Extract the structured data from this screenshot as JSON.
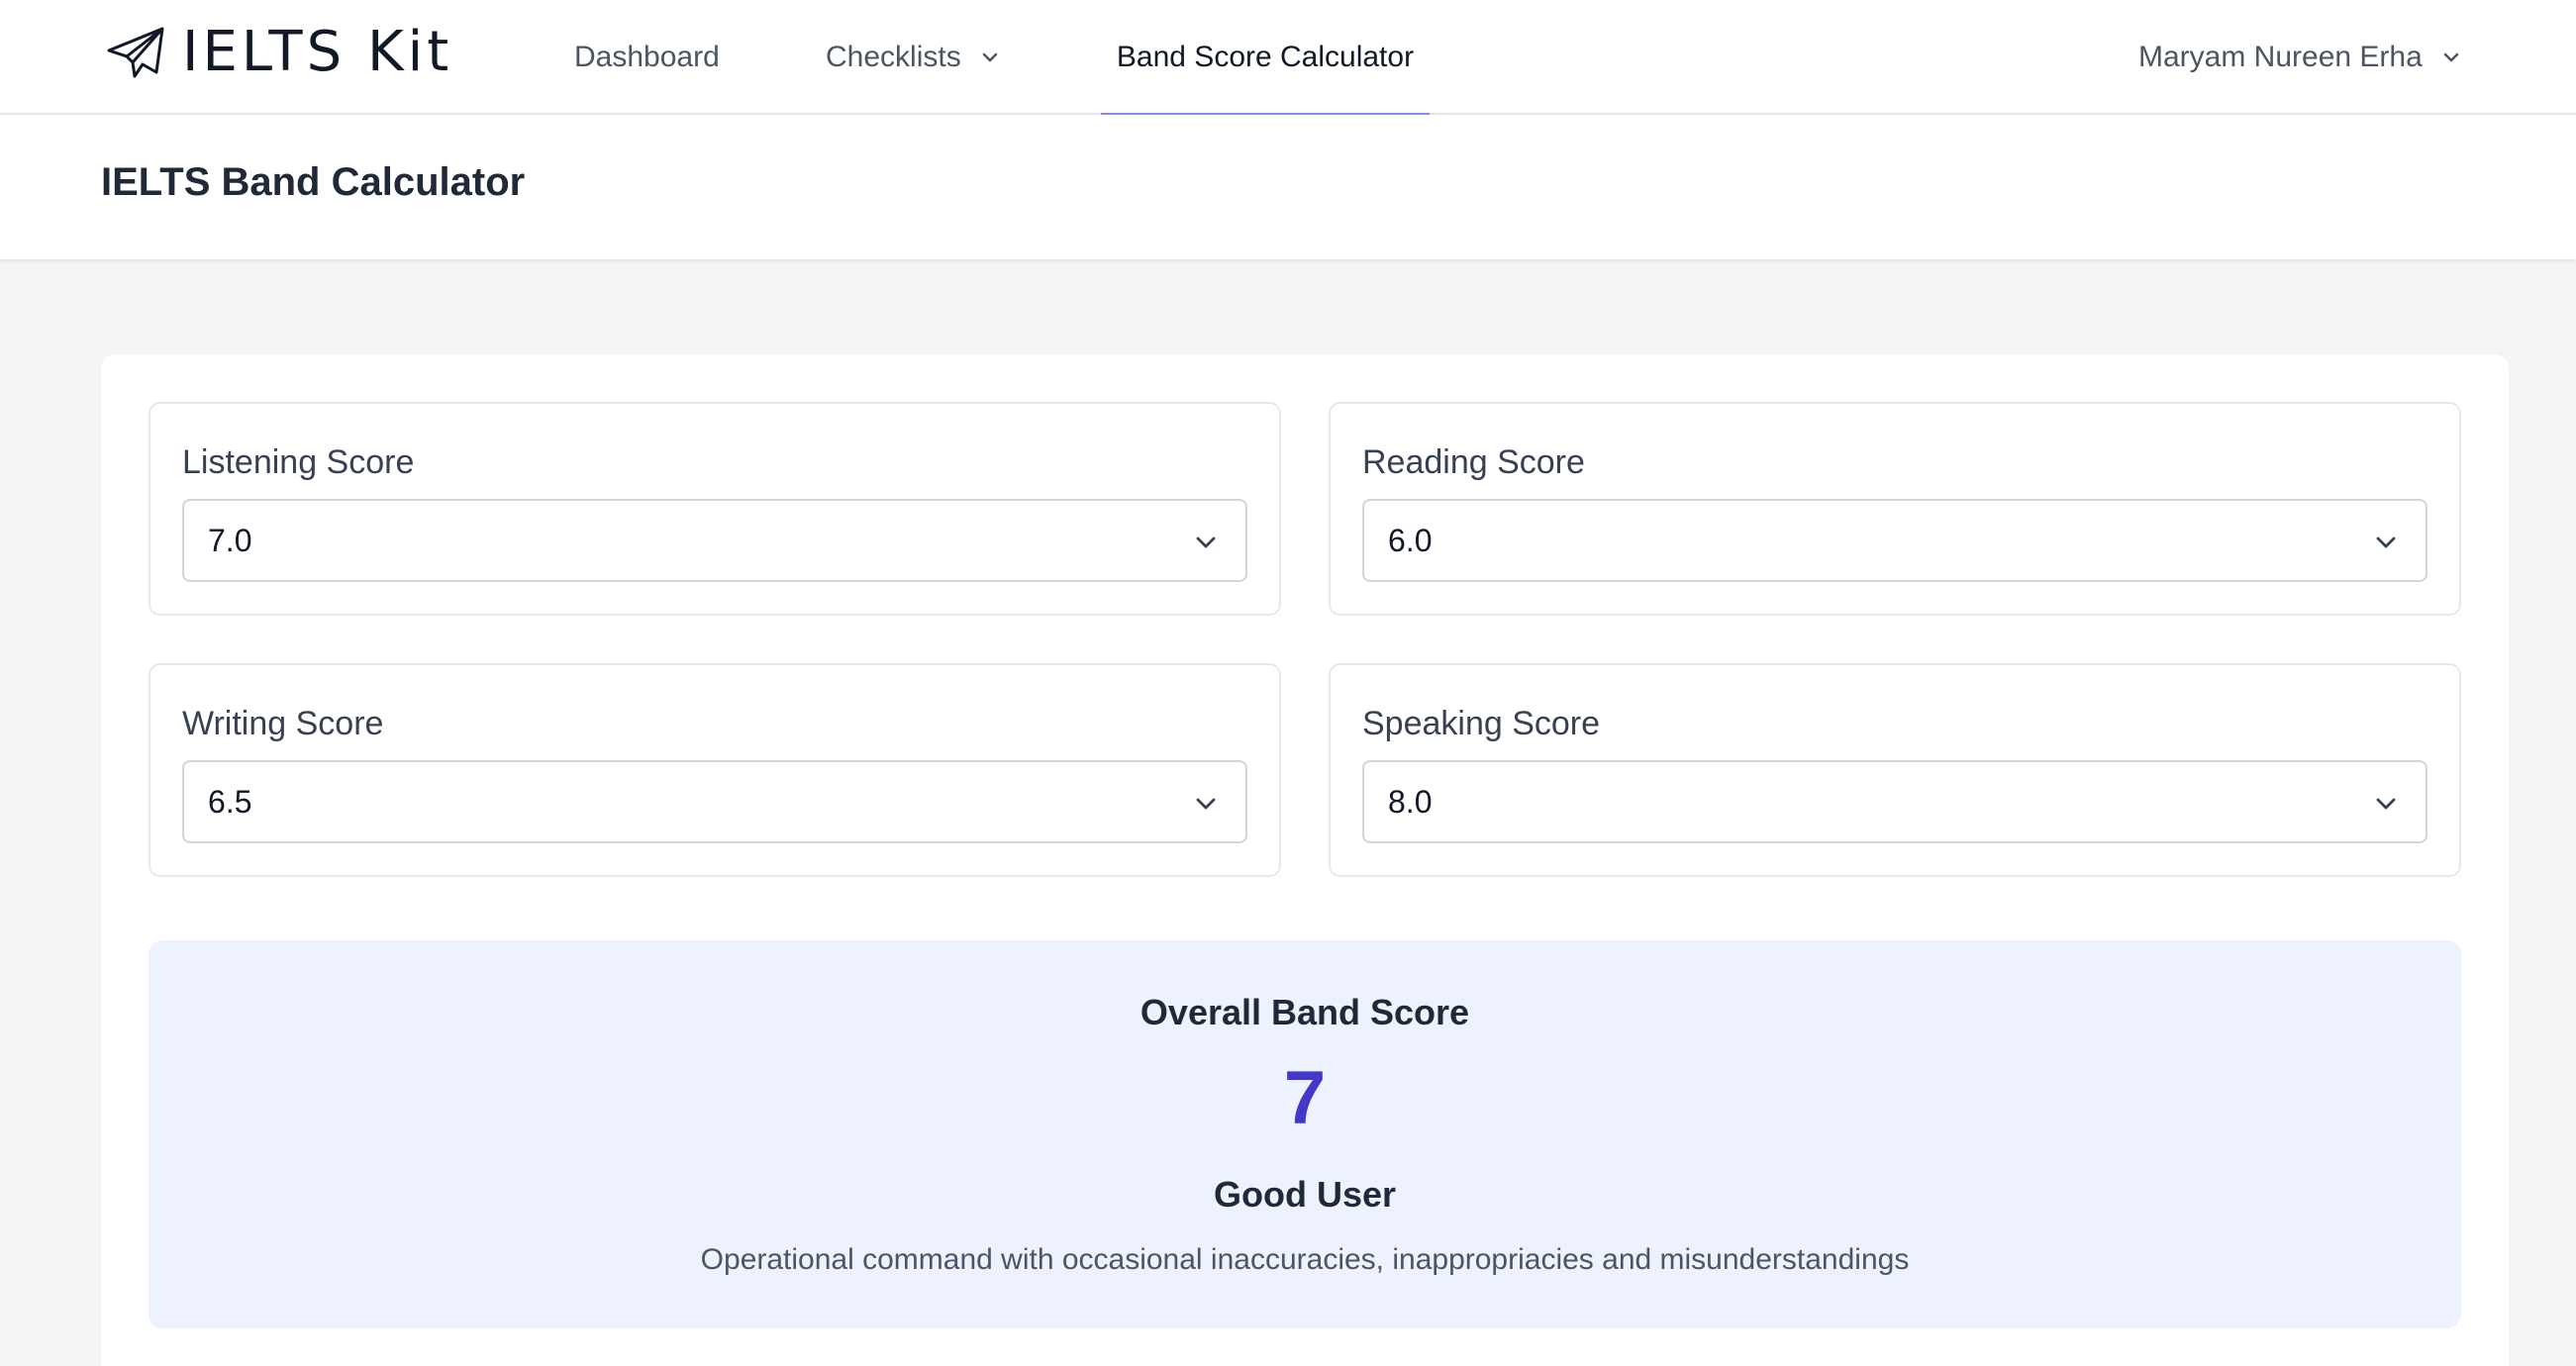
{
  "app": {
    "name": "IELTS Kit",
    "logo_icon": "paper-plane-icon"
  },
  "nav": {
    "dashboard": "Dashboard",
    "checklists": "Checklists",
    "calculator": "Band Score Calculator",
    "active": "Band Score Calculator",
    "user_name": "Maryam Nureen Erha"
  },
  "page": {
    "title": "IELTS Band Calculator"
  },
  "fields": {
    "listening": {
      "label": "Listening Score",
      "value": "7.0"
    },
    "reading": {
      "label": "Reading Score",
      "value": "6.0"
    },
    "writing": {
      "label": "Writing Score",
      "value": "6.5"
    },
    "speaking": {
      "label": "Speaking Score",
      "value": "8.0"
    }
  },
  "result": {
    "heading": "Overall Band Score",
    "score": "7",
    "level": "Good User",
    "description": "Operational command with occasional inaccuracies, inappropriacies and misunderstandings"
  },
  "colors": {
    "accent": "#4338ca",
    "active_tab_underline": "#818cf8",
    "result_bg": "#eef2ff",
    "page_bg": "#f3f4f6"
  }
}
